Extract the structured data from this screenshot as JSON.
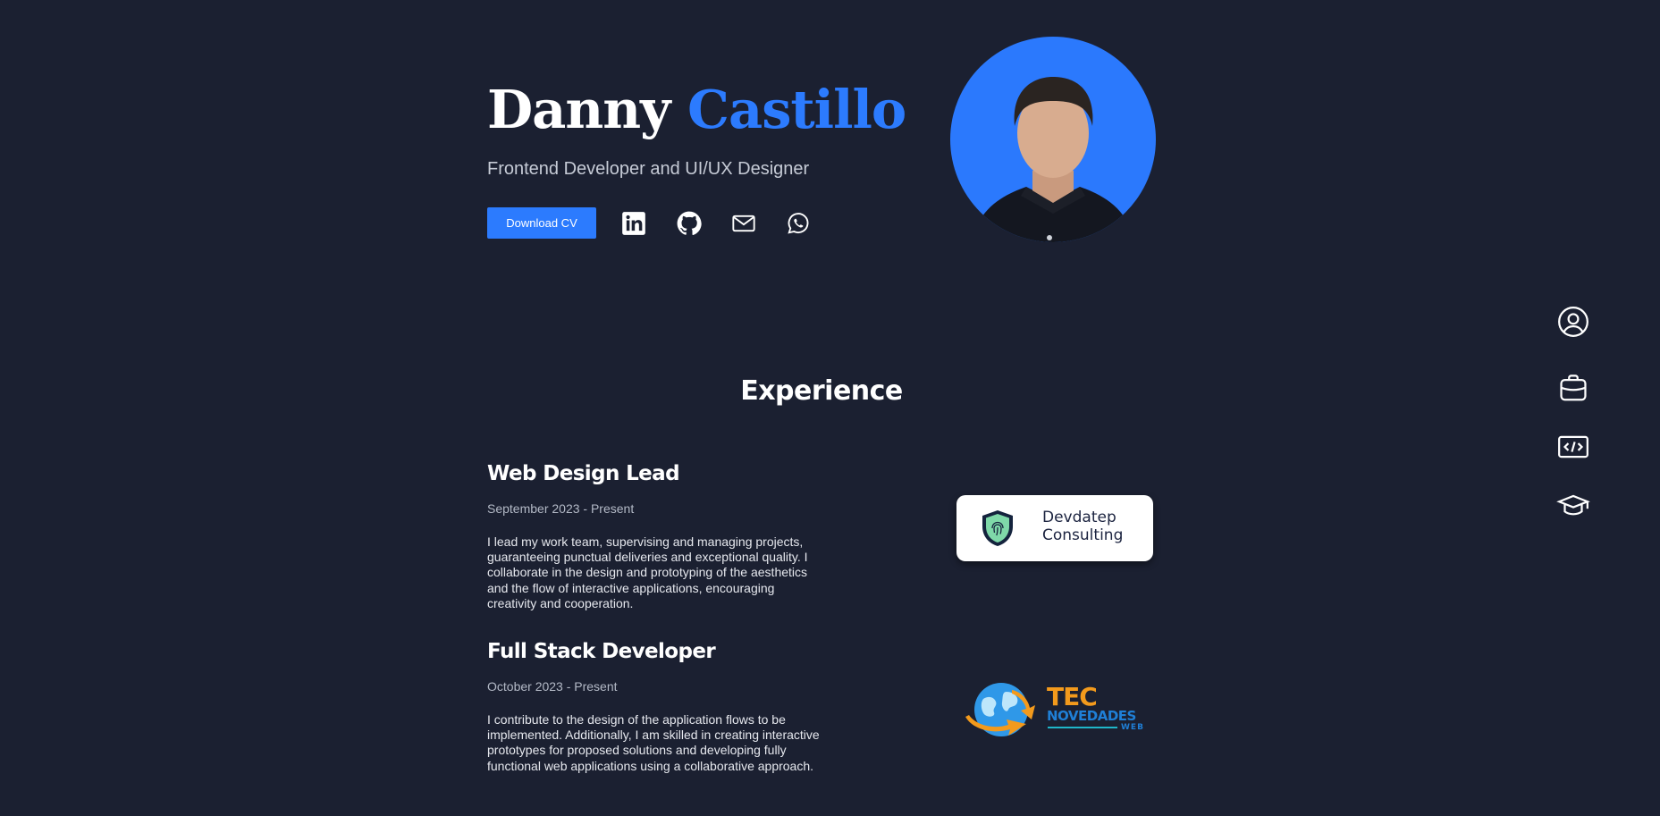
{
  "hero": {
    "first_name": "Danny",
    "last_name": "Castillo",
    "role": "Frontend Developer and UI/UX Designer",
    "download_label": "Download CV",
    "accent_color": "#2c7bfe",
    "background_color": "#1b2031",
    "socials": [
      {
        "icon": "linkedin-icon"
      },
      {
        "icon": "github-icon"
      },
      {
        "icon": "mail-icon"
      },
      {
        "icon": "whatsapp-icon"
      }
    ]
  },
  "side_nav": {
    "items": [
      {
        "icon": "user-circle-icon"
      },
      {
        "icon": "briefcase-icon"
      },
      {
        "icon": "code-icon"
      },
      {
        "icon": "graduation-cap-icon"
      }
    ]
  },
  "experience": {
    "heading": "Experience",
    "jobs": [
      {
        "title": "Web Design Lead",
        "date": "September 2023 - Present",
        "description": "I lead my work team, supervising and managing projects, guaranteeing punctual deliveries and exceptional quality. I collaborate in the design and prototyping of the aesthetics and the flow of interactive applications, encouraging creativity and cooperation.",
        "company_logo": {
          "line1": "Devdatep",
          "line2": "Consulting"
        }
      },
      {
        "title": "Full Stack Developer",
        "date": "October 2023 - Present",
        "description": "I contribute to the design of the application flows to be implemented. Additionally, I am skilled in creating interactive prototypes for proposed solutions and developing fully functional web applications using a collaborative approach.",
        "company_logo": {
          "line1": "TEC",
          "line2": "NOVEDADES",
          "line3": "WEB"
        }
      }
    ]
  }
}
